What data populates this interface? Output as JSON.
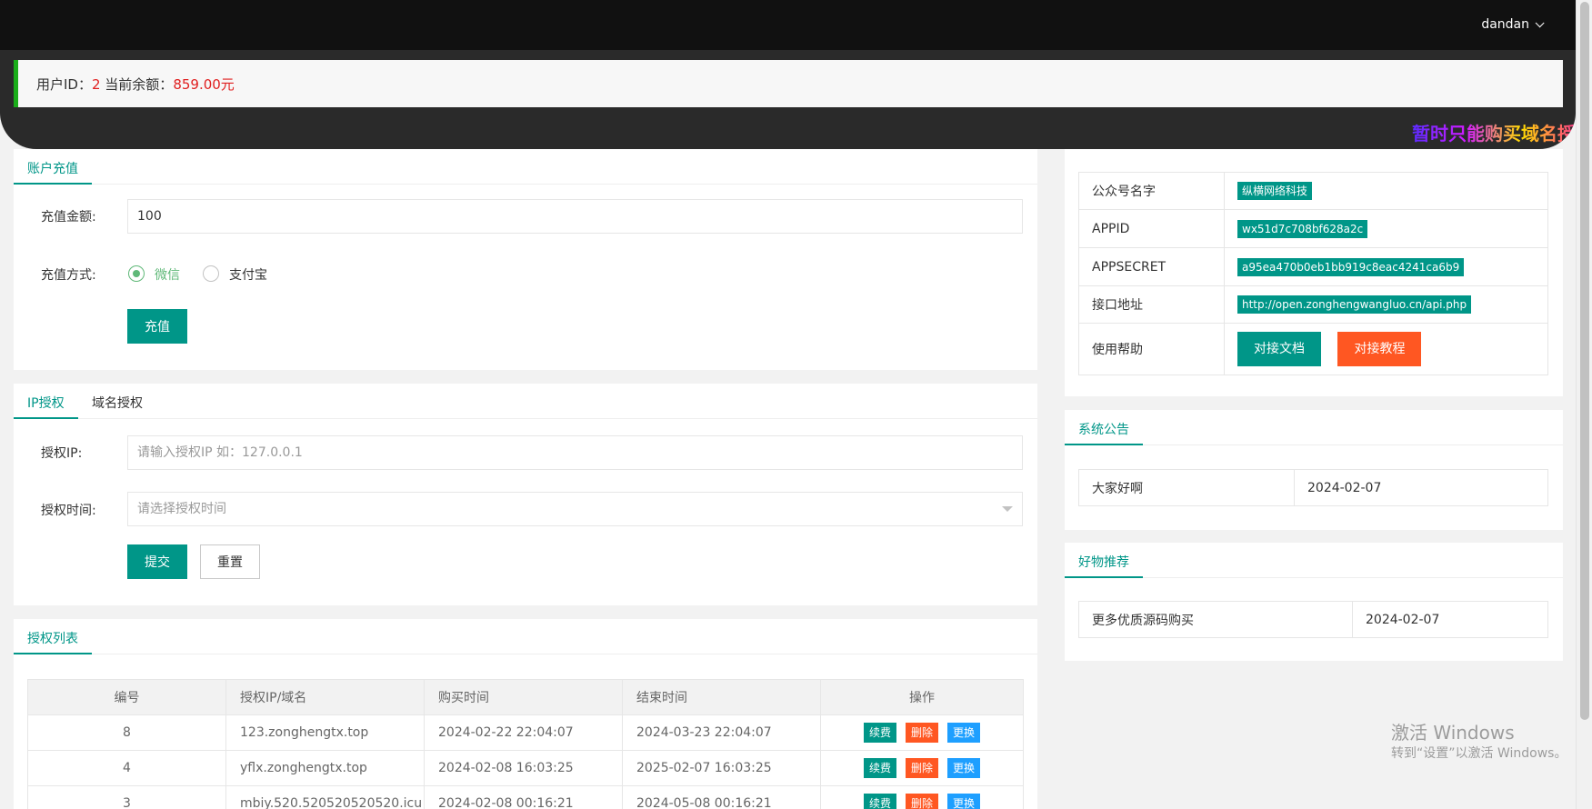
{
  "header": {
    "username": "dandan"
  },
  "marquee": {
    "text": "暂时只能购买域名授"
  },
  "userinfo": {
    "id_label": "用户ID：",
    "id_value": "2",
    "balance_label": " 当前余额：",
    "balance_value": "859.00元"
  },
  "recharge": {
    "tab": "账户充值",
    "amount_label": "充值金额:",
    "amount_value": "100",
    "method_label": "充值方式:",
    "method_wechat": "微信",
    "method_alipay": "支付宝",
    "submit": "充值"
  },
  "auth": {
    "tab_ip": "IP授权",
    "tab_domain": "域名授权",
    "ip_label": "授权IP:",
    "ip_placeholder": "请输入授权IP 如：127.0.0.1",
    "time_label": "授权时间:",
    "time_placeholder": "请选择授权时间",
    "submit": "提交",
    "reset": "重置"
  },
  "auth_list": {
    "tab": "授权列表",
    "columns": [
      "编号",
      "授权IP/域名",
      "购买时间",
      "结束时间",
      "操作"
    ],
    "rows": [
      {
        "id": "8",
        "domain": "123.zonghengtx.top",
        "buy_time": "2024-02-22 22:04:07",
        "end_time": "2024-03-23 22:04:07"
      },
      {
        "id": "4",
        "domain": "yflx.zonghengtx.top",
        "buy_time": "2024-02-08 16:03:25",
        "end_time": "2025-02-07 16:03:25"
      },
      {
        "id": "3",
        "domain": "mbiy.520.520520520520.icu",
        "buy_time": "2024-02-08 00:16:21",
        "end_time": "2024-05-08 00:16:21"
      }
    ],
    "action_renew": "续费",
    "action_delete": "删除",
    "action_change": "更换"
  },
  "account_info": {
    "rows": [
      {
        "label": "公众号名字",
        "value": "纵横网络科技"
      },
      {
        "label": "APPID",
        "value": "wx51d7c708bf628a2c"
      },
      {
        "label": "APPSECRET",
        "value": "a95ea470b0eb1bb919c8eac4241ca6b9"
      },
      {
        "label": "接口地址",
        "value": "http://open.zonghengwangluo.cn/api.php"
      }
    ],
    "help_label": "使用帮助",
    "doc_button": "对接文档",
    "tutorial_button": "对接教程"
  },
  "announcement": {
    "title": "系统公告",
    "content": "大家好啊",
    "date": "2024-02-07"
  },
  "recommend": {
    "title": "好物推荐",
    "content": "更多优质源码购买",
    "date": "2024-02-07"
  },
  "watermark": {
    "line1": "激活 Windows",
    "line2": "转到“设置”以激活 Windows。"
  },
  "colors": {
    "primary": "#009688",
    "danger": "#ff5722",
    "info": "#1e9fff",
    "highlight": "#e02020",
    "accent_border": "#1aad19"
  }
}
